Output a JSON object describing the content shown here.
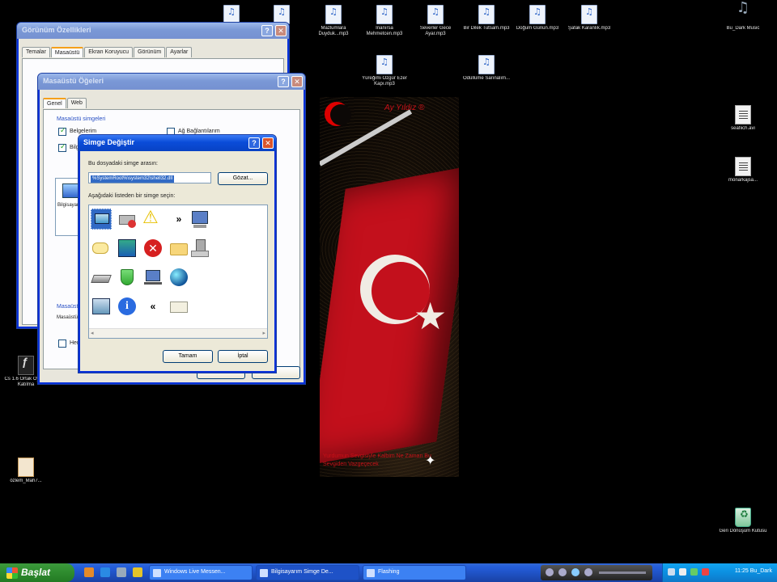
{
  "desktop": {
    "top_icons": [
      {
        "label": "",
        "type": "mp3"
      },
      {
        "label": "",
        "type": "mp3"
      },
      {
        "label": "Mazlumlara Duyduk...mp3",
        "type": "mp3"
      },
      {
        "label": "Inanırsa Mehmetcen.mp3",
        "type": "mp3"
      },
      {
        "label": "Severler Gece Ayar.mp3",
        "type": "mp3"
      },
      {
        "label": "Bir Dilek Tutsam.mp3",
        "type": "mp3"
      },
      {
        "label": "Doğum Günün.mp3",
        "type": "mp3"
      },
      {
        "label": "Şafak Karanlık.mp3",
        "type": "mp3"
      }
    ],
    "second_row_icons": [
      {
        "label": "Yüreğimi Ozgür Ezer Kapı.mp3",
        "type": "mp3"
      },
      {
        "label": "Ödüllüme Sarınalım...",
        "type": "mp3"
      }
    ],
    "right_icons": [
      {
        "label": "Bu_Dark Music",
        "type": "music"
      },
      {
        "label": "seafiich.avi",
        "type": "doc"
      },
      {
        "label": "monarkajsa...",
        "type": "doc"
      }
    ],
    "left_icons": [
      {
        "label": "Cs 1.6 Ortak Oyuna Katılma",
        "type": "game"
      },
      {
        "label": "özlem_Mah7...",
        "type": "doc"
      }
    ],
    "recycle_bin_label": "Geri Dönüşüm Kutusu",
    "wallpaper": {
      "top_text": "Ay Yıldız ®",
      "bottom_text": "Yurdumun Sevgisiyle Kalbim Ne Zaman Bu Sevgiden Vazgeçecek"
    }
  },
  "window_display": {
    "title": "Görünüm Özellikleri",
    "tabs": [
      "Temalar",
      "Masaüstü",
      "Ekran Koruyucu",
      "Görünüm",
      "Ayarlar"
    ],
    "active_tab": "Masaüstü"
  },
  "window_desktop_items": {
    "title": "Masaüstü Öğeleri",
    "tabs": [
      "Genel",
      "Web"
    ],
    "active_tab": "Genel",
    "group_icons": "Masaüstü simgeleri",
    "chk1": "Belgelerim",
    "chk2": "Bilgisayarım",
    "chk3": "Ağ Bağlantılarım",
    "side_label": "Bilgisayarım",
    "group_cleanup": "Masaüstü Temizleme",
    "cleanup_text": "Masaüstü Temizleme Sihirbazı...",
    "cleanup_check": "Her 60 günde bir"
  },
  "window_change_icon": {
    "title": "Simge Değiştir",
    "file_label": "Bu dosyadaki simge arasın:",
    "file_value": "%SystemRoot%\\system32\\shell32.dll",
    "browse_button": "Gözat...",
    "select_label": "Aşağıdaki listeden bir simge seçin:",
    "ok_button": "Tamam",
    "cancel_button": "İptal"
  },
  "taskbar": {
    "start_label": "Başlat",
    "items": [
      {
        "label": "Windows Live Messen...",
        "active": false
      },
      {
        "label": "Bilgisayarım Simge De...",
        "active": true
      },
      {
        "label": "Flashing",
        "active": false
      }
    ],
    "clock": "11:25 Bu_Dark"
  },
  "colors": {
    "xp_blue": "#0a4cd8",
    "start_green": "#2e8b2e",
    "flag_red": "#c3101c",
    "tray_blue": "#0c8fe0"
  }
}
